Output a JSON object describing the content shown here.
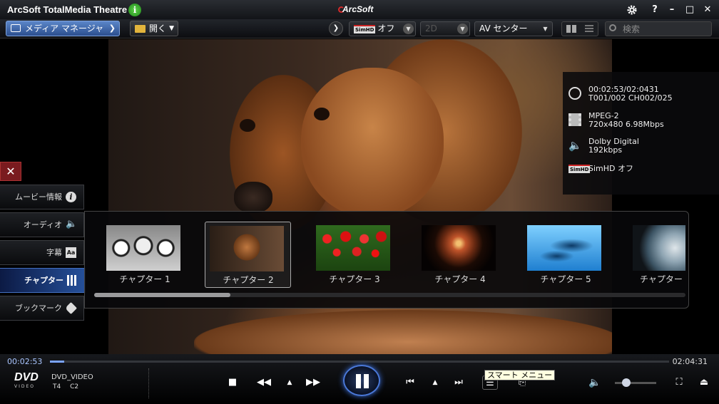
{
  "titlebar": {
    "app_title": "ArcSoft TotalMedia Theatre",
    "info_icon": "i",
    "brand": "ArcSoft",
    "buttons": [
      "gear-icon",
      "?",
      "minimize",
      "maximize",
      "close"
    ],
    "help_label": "?",
    "minimize_label": "–",
    "maximize_label": "□",
    "close_label": "✕"
  },
  "toolbar": {
    "media_manager": "メディア マネージャ",
    "open": "開く",
    "simhd_badge": "SimHD",
    "simhd_value": "オフ",
    "mode_2d": "2D",
    "audio_mode": "AV センター",
    "search_placeholder": "検索"
  },
  "info_panel": {
    "time": "00:02:53/02:0431",
    "title_chapter": "T001/002 CH002/025",
    "video_codec": "MPEG-2",
    "video_detail": "720x480 6.98Mbps",
    "audio_codec": "Dolby Digital",
    "audio_rate": "192kbps",
    "simhd_badge": "SimHD",
    "simhd": "SimHD オフ"
  },
  "side_tabs": [
    {
      "label": "ムービー情報",
      "icon": "info-icon"
    },
    {
      "label": "オーディオ",
      "icon": "speaker-icon"
    },
    {
      "label": "字幕",
      "icon": "subtitle-icon",
      "icon_text": "Aa"
    },
    {
      "label": "チャプター",
      "icon": "chapters-icon"
    },
    {
      "label": "ブックマーク",
      "icon": "bookmark-icon"
    }
  ],
  "chapters": [
    {
      "label": "チャプター 1"
    },
    {
      "label": "チャプター 2"
    },
    {
      "label": "チャプター 3"
    },
    {
      "label": "チャプター 4"
    },
    {
      "label": "チャプター 5"
    },
    {
      "label": "チャプター"
    }
  ],
  "selected_chapter": 2,
  "chapter_scroll_position": 0.23,
  "playback": {
    "elapsed": "00:02:53",
    "total": "02:04:31",
    "progress": 0.023,
    "volume": 0.28
  },
  "disc": {
    "logo": "DVD",
    "logo_sub": "VIDEO",
    "name": "DVD_VIDEO",
    "title_indicator": "T4",
    "chapter_indicator": "C2"
  },
  "tooltip": "スマート メニュー",
  "colors": {
    "accent": "#3b6ed8",
    "close_tab": "#7a1b1f",
    "active_tab": "#25509a"
  }
}
